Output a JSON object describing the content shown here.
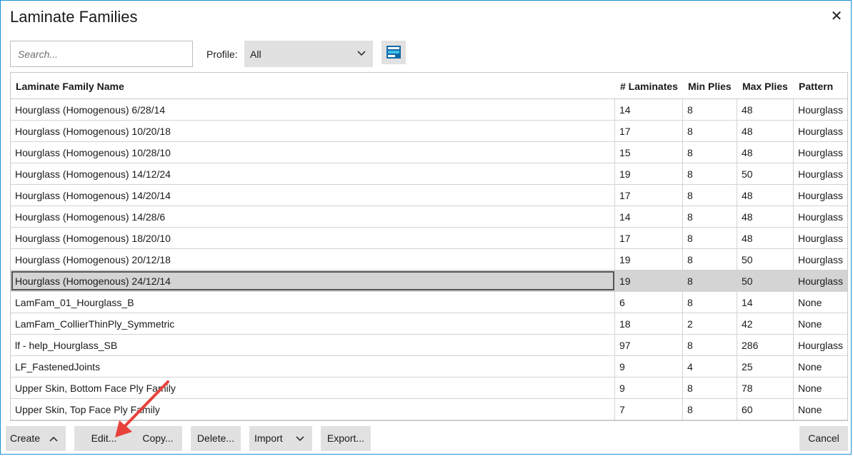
{
  "dialog": {
    "title": "Laminate Families"
  },
  "search": {
    "placeholder": "Search..."
  },
  "profile": {
    "label": "Profile:",
    "selected": "All"
  },
  "columns": [
    "Laminate Family Name",
    "# Laminates",
    "Min Plies",
    "Max Plies",
    "Pattern"
  ],
  "rows": [
    {
      "name": "Hourglass (Homogenous) 6/28/14",
      "laminates": "14",
      "min": "8",
      "max": "48",
      "pattern": "Hourglass"
    },
    {
      "name": "Hourglass (Homogenous) 10/20/18",
      "laminates": "17",
      "min": "8",
      "max": "48",
      "pattern": "Hourglass"
    },
    {
      "name": "Hourglass (Homogenous) 10/28/10",
      "laminates": "15",
      "min": "8",
      "max": "48",
      "pattern": "Hourglass"
    },
    {
      "name": "Hourglass (Homogenous) 14/12/24",
      "laminates": "19",
      "min": "8",
      "max": "50",
      "pattern": "Hourglass"
    },
    {
      "name": "Hourglass (Homogenous) 14/20/14",
      "laminates": "17",
      "min": "8",
      "max": "48",
      "pattern": "Hourglass"
    },
    {
      "name": "Hourglass (Homogenous) 14/28/6",
      "laminates": "14",
      "min": "8",
      "max": "48",
      "pattern": "Hourglass"
    },
    {
      "name": "Hourglass (Homogenous) 18/20/10",
      "laminates": "17",
      "min": "8",
      "max": "48",
      "pattern": "Hourglass"
    },
    {
      "name": "Hourglass (Homogenous) 20/12/18",
      "laminates": "19",
      "min": "8",
      "max": "50",
      "pattern": "Hourglass"
    },
    {
      "name": "Hourglass (Homogenous) 24/12/14",
      "laminates": "19",
      "min": "8",
      "max": "50",
      "pattern": "Hourglass",
      "selected": true
    },
    {
      "name": "LamFam_01_Hourglass_B",
      "laminates": "6",
      "min": "8",
      "max": "14",
      "pattern": "None"
    },
    {
      "name": "LamFam_CollierThinPly_Symmetric",
      "laminates": "18",
      "min": "2",
      "max": "42",
      "pattern": "None"
    },
    {
      "name": "lf - help_Hourglass_SB",
      "laminates": "97",
      "min": "8",
      "max": "286",
      "pattern": "Hourglass"
    },
    {
      "name": "LF_FastenedJoints",
      "laminates": "9",
      "min": "4",
      "max": "25",
      "pattern": "None"
    },
    {
      "name": "Upper Skin, Bottom Face Ply Family",
      "laminates": "9",
      "min": "8",
      "max": "78",
      "pattern": "None"
    },
    {
      "name": "Upper Skin, Top Face Ply Family",
      "laminates": "7",
      "min": "8",
      "max": "60",
      "pattern": "None"
    }
  ],
  "buttons": {
    "create": "Create",
    "edit": "Edit...",
    "copy": "Copy...",
    "delete": "Delete...",
    "import": "Import",
    "export": "Export...",
    "cancel": "Cancel"
  },
  "colors": {
    "accent_border": "#1e90d6",
    "selected_row": "#d4d4d4",
    "arrow": "#e8413b"
  },
  "icons": {
    "close": "close-icon",
    "profile_dropdown": "chevron-down-icon",
    "columns": "column-chooser-icon",
    "create": "chevron-up-icon",
    "import": "chevron-down-icon"
  }
}
